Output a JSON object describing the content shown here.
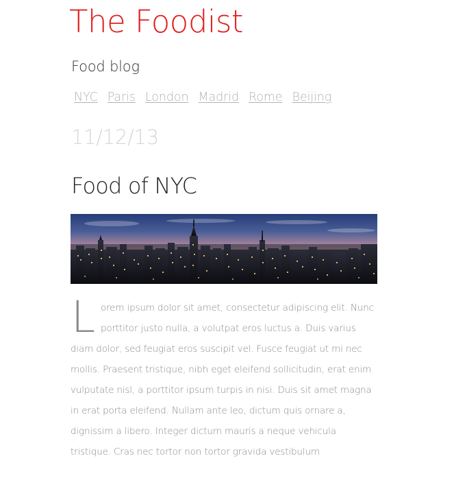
{
  "site": {
    "title": "The Foodist",
    "subtitle": "Food blog",
    "title_color": "#e01f1f"
  },
  "nav": {
    "items": [
      {
        "label": "NYC"
      },
      {
        "label": "Paris"
      },
      {
        "label": "London"
      },
      {
        "label": "Madrid"
      },
      {
        "label": "Rome"
      },
      {
        "label": "Beijing"
      }
    ]
  },
  "post": {
    "date": "11/12/13",
    "title": "Food of NYC",
    "image_alt_icon": "city-skyline-image",
    "dropcap": "L",
    "body": "orem ipsum dolor sit amet, consectetur adipiscing elit. Nunc porttitor justo nulla, a volutpat eros luctus a. Duis varius diam dolor, sed feugiat eros suscipit vel. Fusce feugiat ut mi nec mollis. Praesent tristique, nibh eget eleifend sollicitudin, erat enim vulputate nisl, a porttitor ipsum turpis in nisi. Duis sit amet magna in erat porta eleifend. Nullam ante leo, dictum quis ornare a, dignissim a libero. Integer dictum mauris a neque vehicula tristique. Cras nec tortor non tortor gravida vestibulum"
  }
}
